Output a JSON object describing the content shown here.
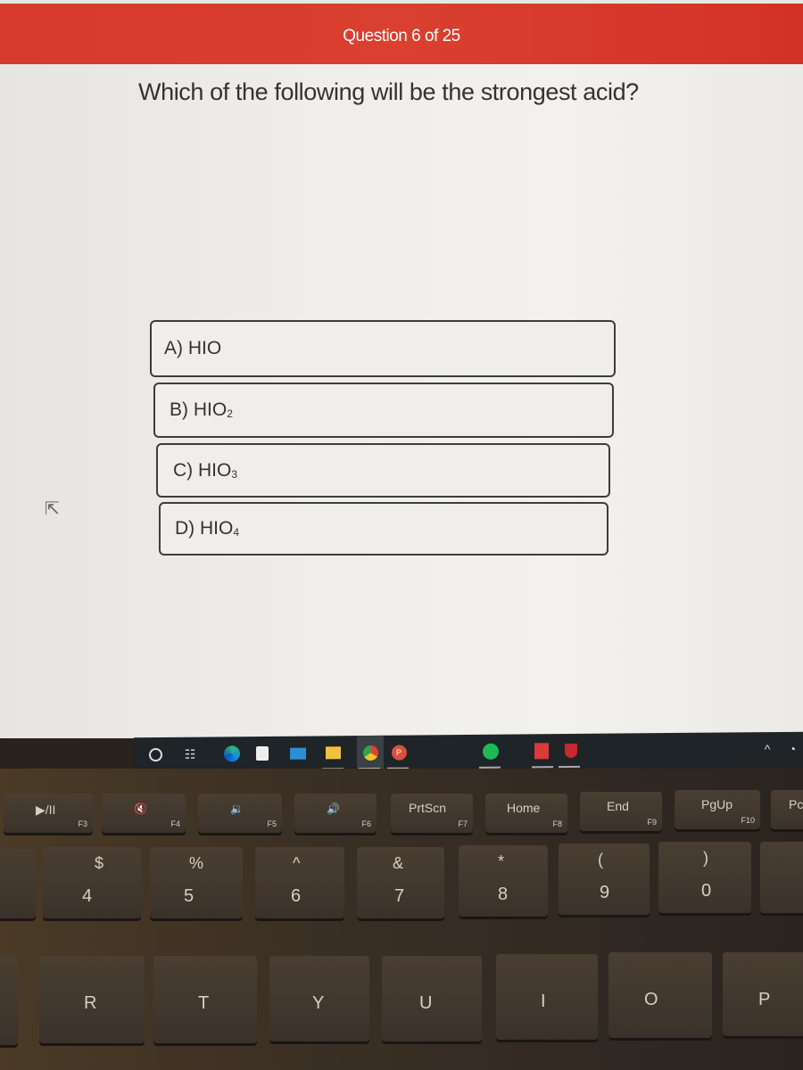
{
  "quiz": {
    "progress_label": "Question 6 of 25",
    "current_question": 6,
    "total_questions": 25,
    "question": "Which of the following will be the strongest acid?",
    "options": [
      {
        "letter": "A)",
        "formula": "HIO",
        "subscript": ""
      },
      {
        "letter": "B)",
        "formula": "HIO",
        "subscript": "2"
      },
      {
        "letter": "C)",
        "formula": "HIO",
        "subscript": "3"
      },
      {
        "letter": "D)",
        "formula": "HIO",
        "subscript": "4"
      }
    ]
  },
  "taskbar": {
    "icons": [
      "cortana-search-icon",
      "task-view-icon",
      "edge-icon",
      "store-icon",
      "mail-icon",
      "file-explorer-icon",
      "chrome-icon",
      "powerpoint-icon",
      "spotify-icon",
      "pdf-app-icon",
      "mcafee-icon"
    ],
    "tray": [
      "chevron-up-icon",
      "wifi-icon"
    ]
  },
  "keyboard": {
    "fn_row": [
      {
        "main": "▶/II",
        "sub": "F3"
      },
      {
        "main": "🔇",
        "sub": "F4"
      },
      {
        "main": "🔉",
        "sub": "F5"
      },
      {
        "main": "🔊",
        "sub": "F6"
      },
      {
        "main": "PrtScn",
        "sub": "F7"
      },
      {
        "main": "Home",
        "sub": "F8"
      },
      {
        "main": "End",
        "sub": "F9"
      },
      {
        "main": "PgUp",
        "sub": "F10"
      },
      {
        "main": "Pc",
        "sub": ""
      }
    ],
    "num_row": [
      {
        "top": "$",
        "main": "4"
      },
      {
        "top": "%",
        "main": "5"
      },
      {
        "top": "^",
        "main": "6"
      },
      {
        "top": "&",
        "main": "7"
      },
      {
        "top": "*",
        "main": "8"
      },
      {
        "top": "(",
        "main": "9"
      },
      {
        "top": ")",
        "main": "0"
      }
    ],
    "letter_row": [
      "R",
      "T",
      "Y",
      "U",
      "I",
      "O",
      "P"
    ]
  }
}
